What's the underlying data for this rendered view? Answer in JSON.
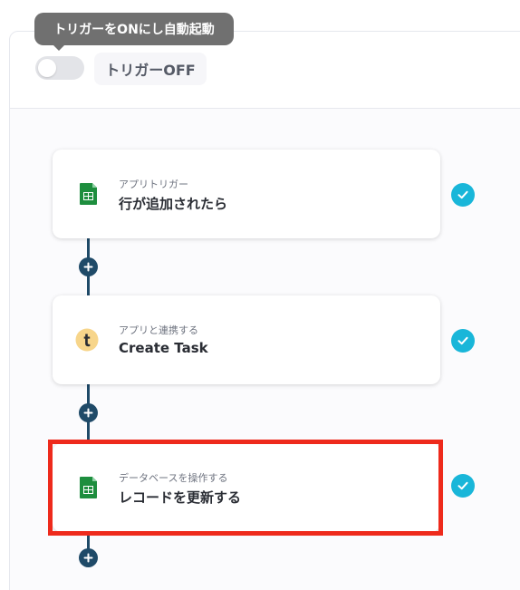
{
  "trigger": {
    "tooltip": "トリガーをONにし自動起動",
    "toggle_label": "トリガーOFF",
    "enabled": false
  },
  "steps": [
    {
      "subtitle": "アプリトリガー",
      "title": "行が追加されたら",
      "icon": "google-sheets-icon",
      "status": "completed"
    },
    {
      "subtitle": "アプリと連携する",
      "title": "Create Task",
      "icon": "toodledo-icon",
      "status": "completed"
    },
    {
      "subtitle": "データベースを操作する",
      "title": "レコードを更新する",
      "icon": "google-sheets-icon",
      "status": "completed",
      "highlighted": true
    }
  ],
  "colors": {
    "check": "#19b6d9",
    "connector": "#1f4a68",
    "highlight": "#ee2a1c",
    "sheets_green": "#1e8e3e",
    "toodledo_bg": "#f7d58a"
  }
}
